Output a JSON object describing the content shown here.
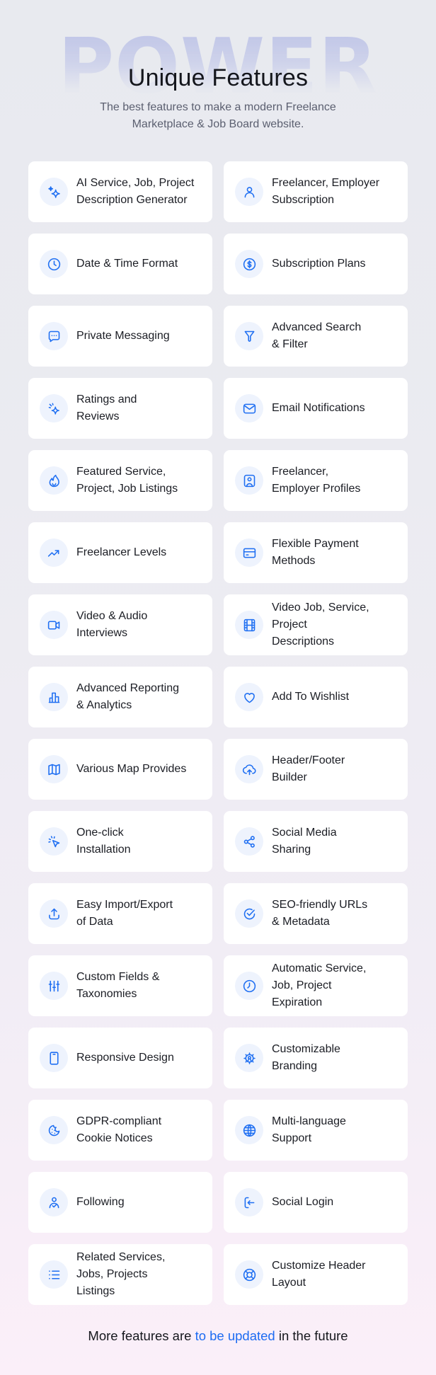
{
  "header": {
    "watermark": "POWER",
    "title": "Unique Features",
    "subtitle_lines": [
      "The best features to make a modern Freelance",
      "Marketplace & Job Board website."
    ]
  },
  "features": [
    {
      "icon": "sparkles-icon",
      "lines": [
        "AI Service, Job, Project",
        "Description Generator"
      ]
    },
    {
      "icon": "user-icon",
      "lines": [
        "Freelancer, Employer",
        "Subscription"
      ]
    },
    {
      "icon": "clock-icon",
      "lines": [
        "Date & Time Format"
      ]
    },
    {
      "icon": "dollar-circle-icon",
      "lines": [
        "Subscription Plans"
      ]
    },
    {
      "icon": "chat-bubble-icon",
      "lines": [
        "Private Messaging"
      ]
    },
    {
      "icon": "filter-icon",
      "lines": [
        "Advanced Search",
        "& Filter"
      ]
    },
    {
      "icon": "sparkle-rating-icon",
      "lines": [
        "Ratings and",
        "Reviews"
      ]
    },
    {
      "icon": "envelope-icon",
      "lines": [
        "Email Notifications"
      ]
    },
    {
      "icon": "flame-icon",
      "lines": [
        "Featured Service,",
        "Project, Job Listings"
      ]
    },
    {
      "icon": "user-profile-icon",
      "lines": [
        "Freelancer,",
        "Employer Profiles"
      ]
    },
    {
      "icon": "trending-up-icon",
      "lines": [
        "Freelancer Levels"
      ]
    },
    {
      "icon": "credit-card-icon",
      "lines": [
        "Flexible Payment",
        "Methods"
      ]
    },
    {
      "icon": "video-camera-icon",
      "lines": [
        "Video & Audio",
        "Interviews"
      ]
    },
    {
      "icon": "film-icon",
      "lines": [
        "Video Job, Service,",
        "Project",
        "Descriptions"
      ]
    },
    {
      "icon": "bar-chart-icon",
      "lines": [
        "Advanced Reporting",
        "& Analytics"
      ]
    },
    {
      "icon": "heart-icon",
      "lines": [
        "Add To Wishlist"
      ]
    },
    {
      "icon": "map-icon",
      "lines": [
        "Various Map Provides"
      ]
    },
    {
      "icon": "cloud-upload-icon",
      "lines": [
        "Header/Footer",
        "Builder"
      ]
    },
    {
      "icon": "cursor-click-icon",
      "lines": [
        "One-click",
        "Installation"
      ]
    },
    {
      "icon": "share-icon",
      "lines": [
        "Social Media",
        "Sharing"
      ]
    },
    {
      "icon": "upload-icon",
      "lines": [
        "Easy Import/Export",
        "of Data"
      ]
    },
    {
      "icon": "check-circle-icon",
      "lines": [
        "SEO-friendly URLs",
        "& Metadata"
      ]
    },
    {
      "icon": "sliders-icon",
      "lines": [
        "Custom Fields &",
        "Taxonomies"
      ]
    },
    {
      "icon": "clock-expiration-icon",
      "lines": [
        "Automatic Service,",
        "Job, Project",
        "Expiration"
      ]
    },
    {
      "icon": "smartphone-icon",
      "lines": [
        "Responsive Design"
      ]
    },
    {
      "icon": "gear-icon",
      "lines": [
        "Customizable",
        "Branding"
      ]
    },
    {
      "icon": "cookie-icon",
      "lines": [
        "GDPR-compliant",
        "Cookie Notices"
      ]
    },
    {
      "icon": "globe-icon",
      "lines": [
        "Multi-language",
        "Support"
      ]
    },
    {
      "icon": "user-check-icon",
      "lines": [
        "Following"
      ]
    },
    {
      "icon": "login-icon",
      "lines": [
        "Social Login"
      ]
    },
    {
      "icon": "list-icon",
      "lines": [
        "Related Services,",
        "Jobs, Projects",
        "Listings"
      ]
    },
    {
      "icon": "life-buoy-icon",
      "lines": [
        "Customize Header",
        "Layout"
      ]
    }
  ],
  "footer": {
    "prefix": "More features are",
    "highlight": "to be updated",
    "suffix": "in the future"
  },
  "colors": {
    "accent": "#1f6ff2",
    "icon_bg": "#eef3fd",
    "card_bg": "#ffffff",
    "text": "#1b1d24",
    "subtitle": "#5b5f70",
    "bg_top": "#e8eaef",
    "bg_bottom": "#fbeff9"
  }
}
